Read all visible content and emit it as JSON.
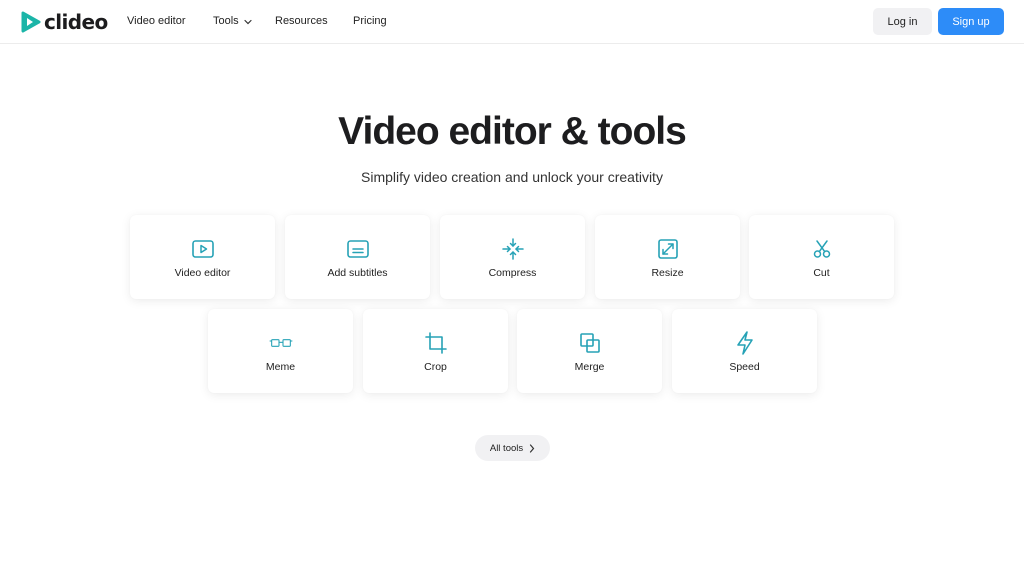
{
  "header": {
    "logo_text": "clideo",
    "nav": [
      {
        "label": "Video editor"
      },
      {
        "label": "Tools"
      },
      {
        "label": "Resources"
      },
      {
        "label": "Pricing"
      }
    ],
    "login_label": "Log in",
    "signup_label": "Sign up"
  },
  "hero": {
    "title": "Video editor & tools",
    "subtitle": "Simplify video creation and unlock your creativity"
  },
  "tools": [
    {
      "label": "Video editor",
      "icon": "play-window-icon"
    },
    {
      "label": "Add subtitles",
      "icon": "subtitles-icon"
    },
    {
      "label": "Compress",
      "icon": "compress-icon"
    },
    {
      "label": "Resize",
      "icon": "resize-icon"
    },
    {
      "label": "Cut",
      "icon": "scissors-icon"
    },
    {
      "label": "Meme",
      "icon": "meme-icon"
    },
    {
      "label": "Crop",
      "icon": "crop-icon"
    },
    {
      "label": "Merge",
      "icon": "merge-icon"
    },
    {
      "label": "Speed",
      "icon": "lightning-icon"
    }
  ],
  "all_tools_label": "All tools",
  "colors": {
    "accent": "#2d8cf8",
    "icon_teal": "#26a2b6",
    "logo_teal": "#1bb5a8"
  }
}
